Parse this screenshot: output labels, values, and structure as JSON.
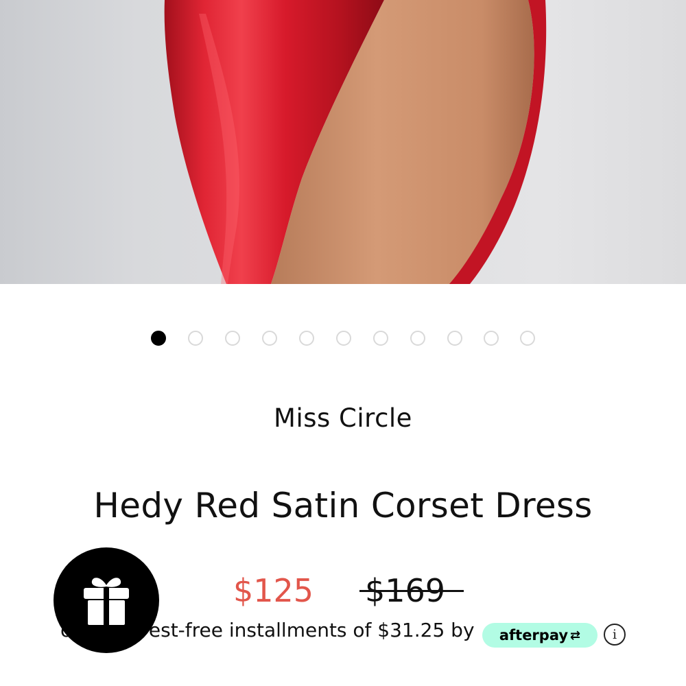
{
  "product": {
    "brand": "Miss Circle",
    "title": "Hedy Red Satin Corset Dress",
    "sale_price": "$125",
    "original_price": "$169",
    "installments_text": "or 4 interest-free installments of $31.25 by",
    "afterpay_label": "afterpay",
    "afterpay_arrow": "⇄"
  },
  "carousel": {
    "total_slides": 11,
    "active_index": 0
  },
  "icons": {
    "info": "i",
    "gift": "gift-icon"
  },
  "colors": {
    "sale_price": "#e2564b",
    "afterpay_badge": "#b2fce4",
    "dress_red": "#d31a2a"
  }
}
